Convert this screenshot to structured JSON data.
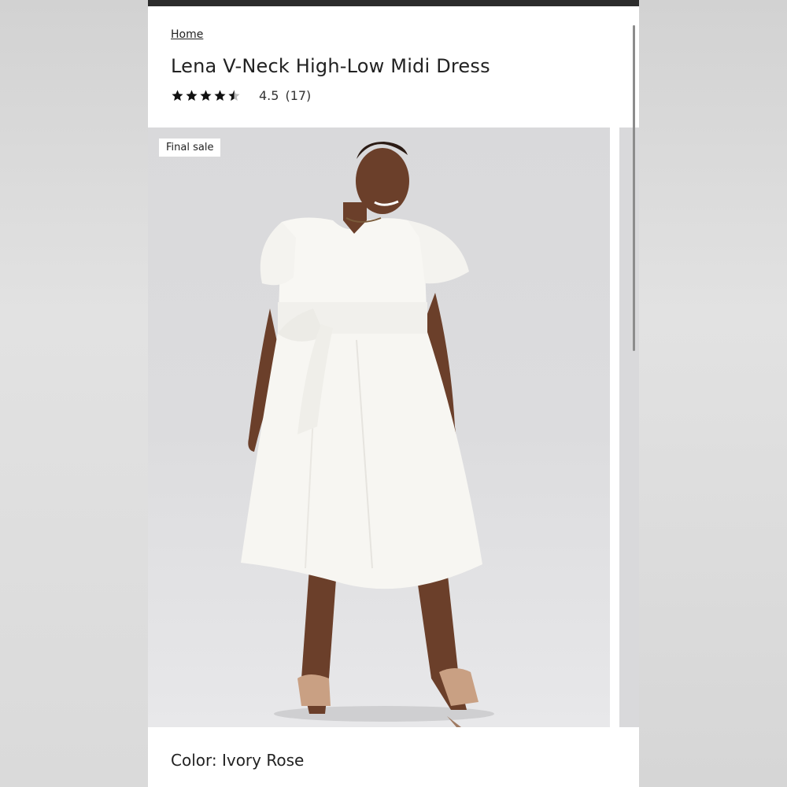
{
  "breadcrumb": {
    "home": "Home"
  },
  "product": {
    "title": "Lena V-Neck High-Low Midi Dress",
    "rating_value": "4.5",
    "rating_count": "(17)",
    "stars": 4.5
  },
  "gallery": {
    "badge": "Final sale",
    "image": "model-photo"
  },
  "color": {
    "label": "Color: Ivory Rose"
  }
}
